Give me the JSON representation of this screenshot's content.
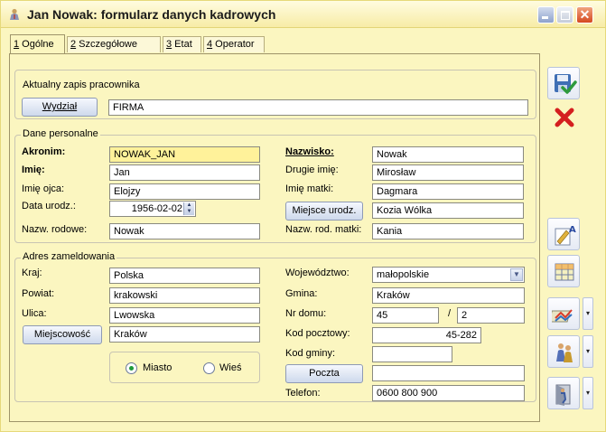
{
  "window": {
    "title": "Jan Nowak: formularz danych kadrowych"
  },
  "tabs": [
    {
      "hotkey": "1",
      "rest": " Ogólne",
      "active": true
    },
    {
      "hotkey": "2",
      "rest": " Szczegółowe",
      "active": false
    },
    {
      "hotkey": "3",
      "rest": " Etat",
      "active": false
    },
    {
      "hotkey": "4",
      "rest": " Operator",
      "active": false
    }
  ],
  "current": {
    "section_label": "Aktualny zapis pracownika",
    "department_button": "Wydział",
    "department_value": "FIRMA"
  },
  "personal": {
    "legend": "Dane personalne",
    "acronym_label": "Akronim:",
    "acronym_value": "NOWAK_JAN",
    "first_name_label": "Imię:",
    "first_name_value": "Jan",
    "father_label": "Imię ojca:",
    "father_value": "Elojzy",
    "birth_date_label": "Data urodz.:",
    "birth_date_value": "1956-02-02",
    "family_name_label": "Nazw. rodowe:",
    "family_name_value": "Nowak",
    "surname_label": "Nazwisko:",
    "surname_value": "Nowak",
    "second_name_label": "Drugie imię:",
    "second_name_value": "Mirosław",
    "mother_label": "Imię matki:",
    "mother_value": "Dagmara",
    "birth_place_button": "Miejsce urodz.",
    "birth_place_value": "Kozia Wólka",
    "mother_family_label": "Nazw. rod. matki:",
    "mother_family_value": "Kania"
  },
  "address": {
    "legend": "Adres zameldowania",
    "country_label": "Kraj:",
    "country_value": "Polska",
    "district_label": "Powiat:",
    "district_value": "krakowski",
    "street_label": "Ulica:",
    "street_value": "Lwowska",
    "city_button": "Miejscowość",
    "city_value": "Kraków",
    "radio_town": "Miasto",
    "radio_village": "Wieś",
    "town_selected": true,
    "voivodeship_label": "Województwo:",
    "voivodeship_value": "małopolskie",
    "commune_label": "Gmina:",
    "commune_value": "Kraków",
    "house_label": "Nr domu:",
    "house_value": "45",
    "flat_separator": "/",
    "flat_value": "2",
    "postal_code_label": "Kod pocztowy:",
    "postal_code_value": "45-282",
    "commune_code_label": "Kod gminy:",
    "commune_code_value": "",
    "post_button": "Poczta",
    "post_value": "",
    "phone_label": "Telefon:",
    "phone_value": "0600 800 900"
  },
  "toolbar": {
    "save_icon": "save-disk-icon",
    "cancel_icon": "cancel-x-icon",
    "dropdown_glyph": "▾"
  }
}
